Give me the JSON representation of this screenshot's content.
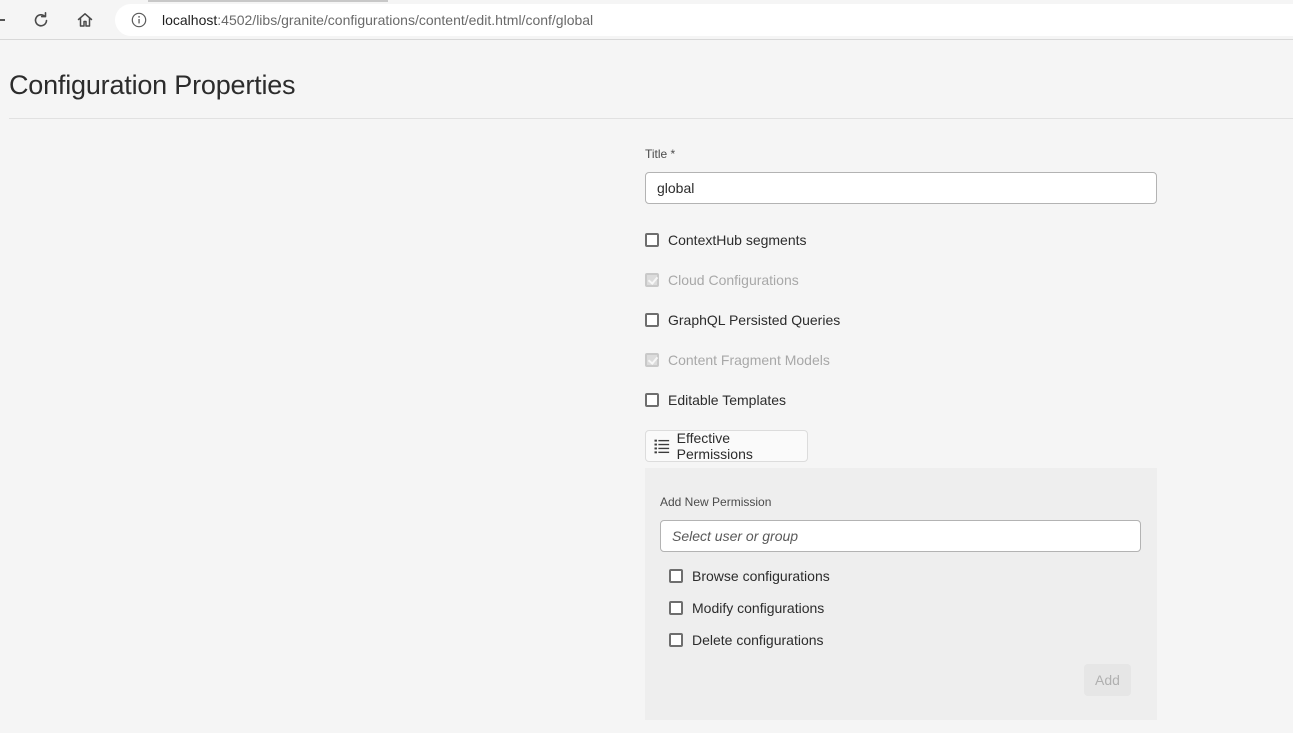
{
  "browser": {
    "url_host": "localhost",
    "url_path": ":4502/libs/granite/configurations/content/edit.html/conf/global"
  },
  "page": {
    "title": "Configuration Properties"
  },
  "form": {
    "title_label": "Title *",
    "title_value": "global",
    "checkboxes": [
      {
        "label": "ContextHub segments",
        "checked": false,
        "disabled": false
      },
      {
        "label": "Cloud Configurations",
        "checked": true,
        "disabled": true
      },
      {
        "label": "GraphQL Persisted Queries",
        "checked": false,
        "disabled": false
      },
      {
        "label": "Content Fragment Models",
        "checked": true,
        "disabled": true
      },
      {
        "label": "Editable Templates",
        "checked": false,
        "disabled": false
      }
    ],
    "effective_permissions_label": "Effective Permissions"
  },
  "permissions": {
    "add_new_label": "Add New Permission",
    "user_placeholder": "Select user or group",
    "options": [
      {
        "label": "Browse configurations",
        "checked": false
      },
      {
        "label": "Modify configurations",
        "checked": false
      },
      {
        "label": "Delete configurations",
        "checked": false
      }
    ],
    "add_button_label": "Add"
  }
}
